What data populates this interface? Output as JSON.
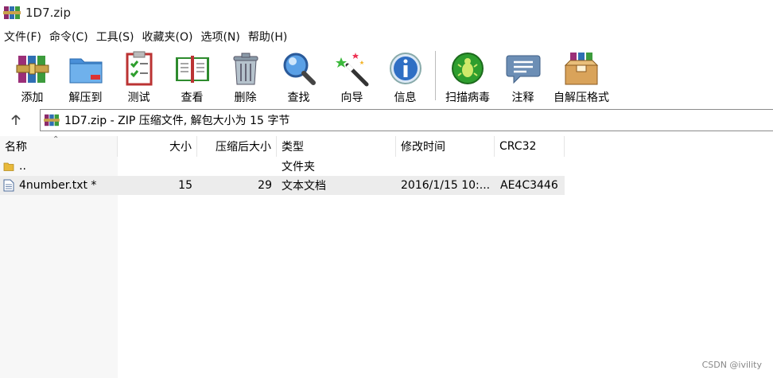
{
  "window": {
    "title": "1D7.zip"
  },
  "menu": [
    "文件(F)",
    "命令(C)",
    "工具(S)",
    "收藏夹(O)",
    "选项(N)",
    "帮助(H)"
  ],
  "toolbar": {
    "add": "添加",
    "extract": "解压到",
    "test": "测试",
    "view": "查看",
    "delete": "删除",
    "find": "查找",
    "wizard": "向导",
    "info": "信息",
    "scan": "扫描病毒",
    "comment": "注释",
    "sfx": "自解压格式"
  },
  "address": {
    "text": "1D7.zip - ZIP 压缩文件, 解包大小为 15 字节"
  },
  "columns": [
    "名称",
    "大小",
    "压缩后大小",
    "类型",
    "修改时间",
    "CRC32"
  ],
  "rows": [
    {
      "name": "..",
      "size": "",
      "packed": "",
      "type": "文件夹",
      "modified": "",
      "crc": ""
    },
    {
      "name": "4number.txt *",
      "size": "15",
      "packed": "29",
      "type": "文本文档",
      "modified": "2016/1/15 10:...",
      "crc": "AE4C3446"
    }
  ],
  "watermark": "CSDN @ivility",
  "colors": {
    "accent_green": "#2e9e2e",
    "folder": "#e8b93a",
    "selection": "#ececec"
  }
}
